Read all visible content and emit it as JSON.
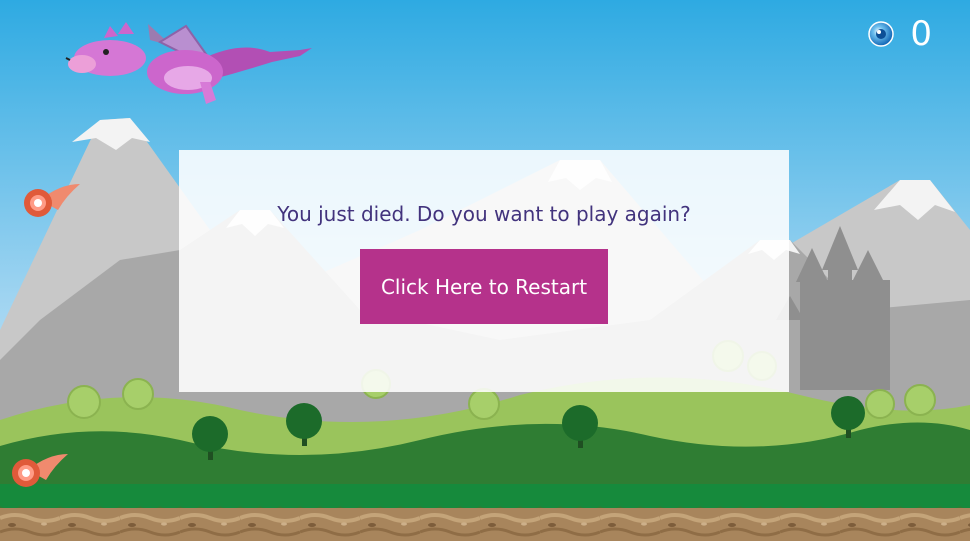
{
  "game": {
    "score": "0",
    "coin_icon": "blue-orb-coin-icon",
    "message": "You just died. Do you want to play again?",
    "restart_label": "Click Here to Restart"
  },
  "colors": {
    "sky_top": "#2eaae2",
    "sky_bottom": "#d6ecf8",
    "mountain": "#b9b9b9",
    "snow": "#f4f4f4",
    "hill_light": "#9ac45c",
    "hill_dark": "#2e7d32",
    "grass": "#168a3c",
    "dirt": "#a8855c",
    "dragon": "#cc66cc",
    "fireball": "#e05a3a",
    "overlay_text": "#42337d",
    "button": "#b5328b"
  }
}
